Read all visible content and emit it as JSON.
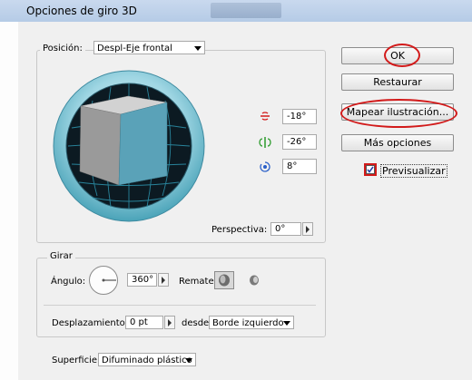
{
  "window": {
    "title": "Opciones de giro 3D"
  },
  "position": {
    "label": "Posición",
    "value": "Despl-Eje frontal"
  },
  "rotation": {
    "x_value": "-18°",
    "y_value": "-26°",
    "z_value": "8°",
    "x_icon": "rotate-x-icon",
    "y_icon": "rotate-y-icon",
    "z_icon": "rotate-z-icon"
  },
  "perspective": {
    "label": "Perspectiva:",
    "value": "0°"
  },
  "revolve": {
    "title": "Girar",
    "angle_label": "Ángulo:",
    "angle_value": "360°",
    "cap_label": "Remate:",
    "offset_label": "Desplazamiento:",
    "offset_value": "0 pt",
    "from_label": "desde",
    "from_value": "Borde izquierdo"
  },
  "surface": {
    "label": "Superficie:",
    "value": "Difuminado plástico"
  },
  "buttons": {
    "ok": "OK",
    "reset": "Restaurar",
    "map_art": "Mapear ilustración...",
    "more_options": "Más opciones"
  },
  "preview": {
    "label": "Previsualizar",
    "checked": true
  },
  "colors": {
    "cube_front": "#5aa2b8",
    "cube_top": "#cfcfcf",
    "cube_side": "#9c9c9c",
    "ring": "#5fb8cc",
    "highlight": "#d21a1a"
  }
}
